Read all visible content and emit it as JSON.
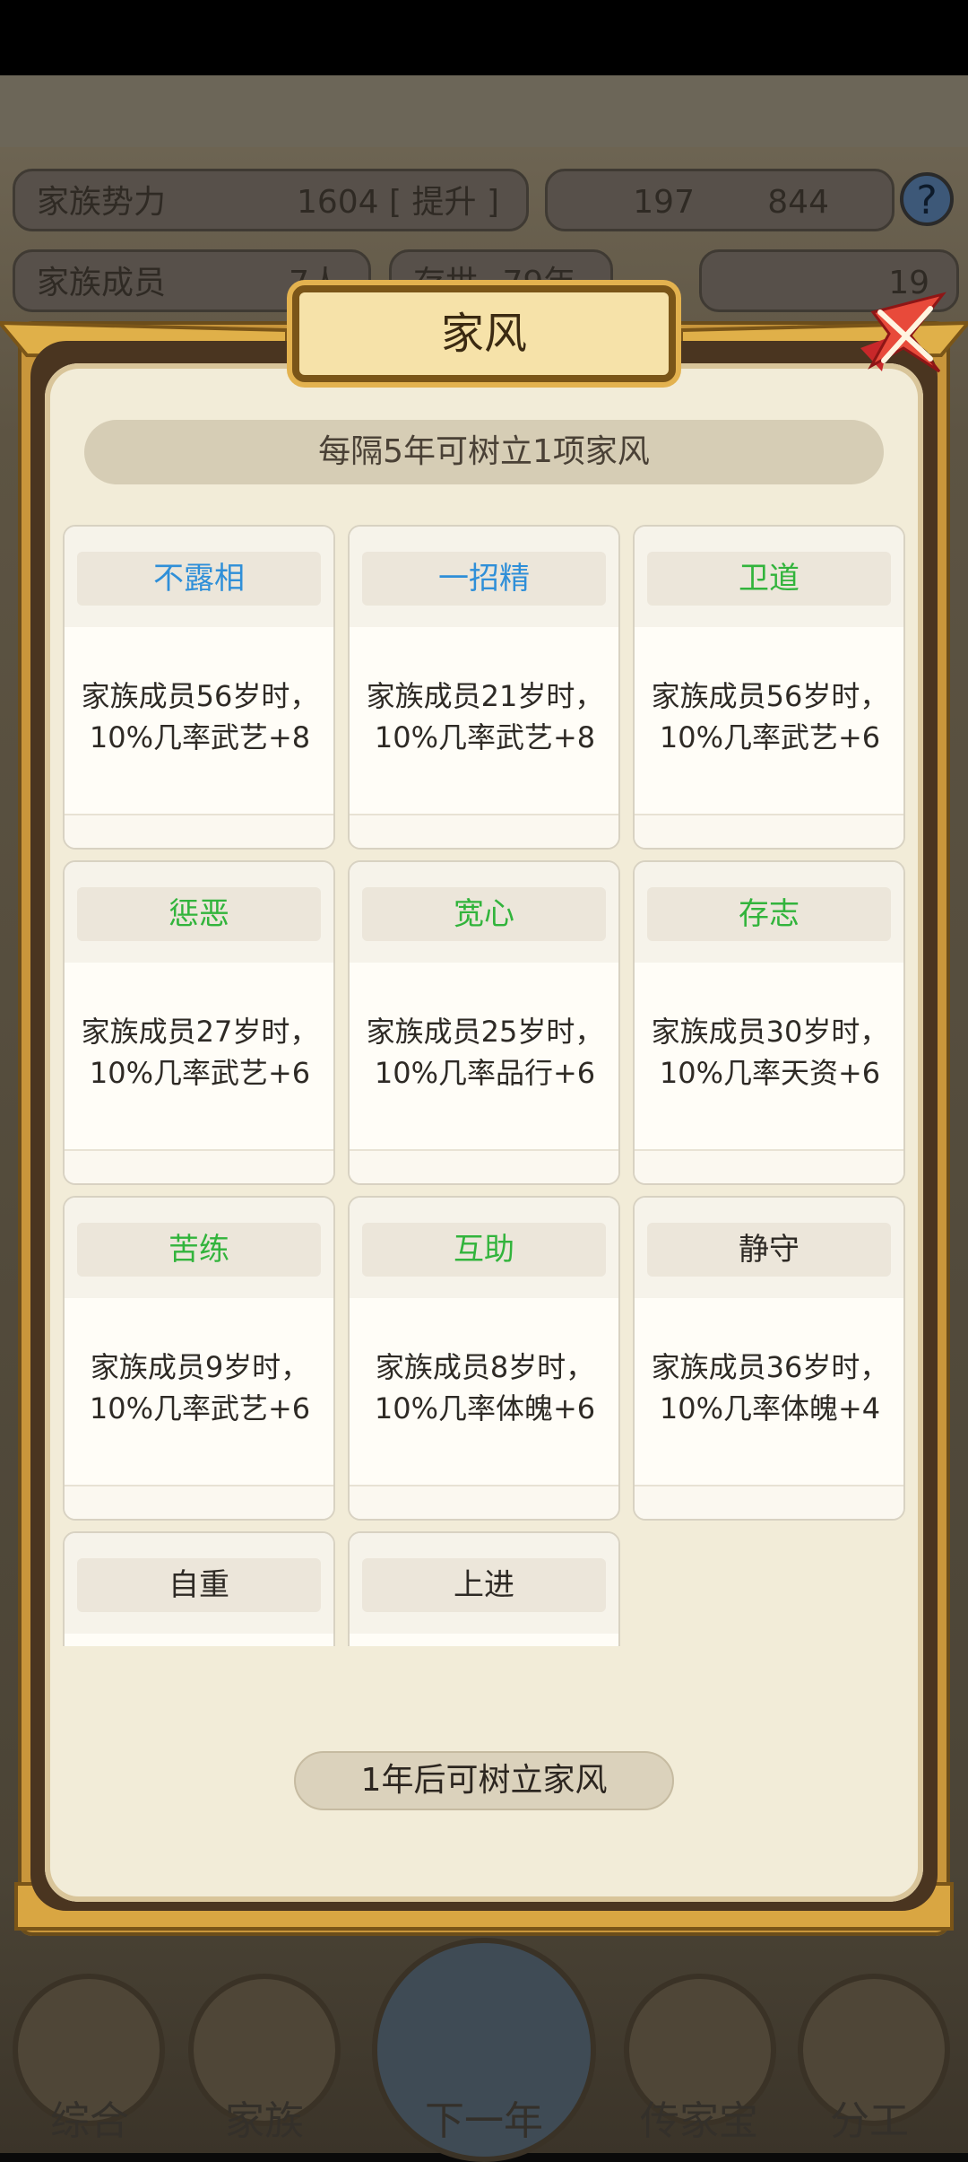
{
  "background": {
    "stats": [
      {
        "label": "家族势力",
        "value": "1604 [ 提升 ]"
      },
      {
        "label": "家族成员",
        "value": "7人"
      },
      {
        "label": "存世",
        "value": "79年"
      }
    ],
    "currency": {
      "silver": "197",
      "coins": "844",
      "gold": "19"
    },
    "nav": [
      "综合",
      "家族",
      "下一年",
      "传家宝",
      "分工"
    ]
  },
  "modal": {
    "title": "家风",
    "hint": "每隔5年可树立1项家风",
    "cards": [
      {
        "name": "不露相",
        "desc": "家族成员56岁时，10%几率武艺+8",
        "color": "#2f8fd8"
      },
      {
        "name": "一招精",
        "desc": "家族成员21岁时，10%几率武艺+8",
        "color": "#2f8fd8"
      },
      {
        "name": "卫道",
        "desc": "家族成员56岁时，10%几率武艺+6",
        "color": "#32b43c"
      },
      {
        "name": "惩恶",
        "desc": "家族成员27岁时，10%几率武艺+6",
        "color": "#32b43c"
      },
      {
        "name": "宽心",
        "desc": "家族成员25岁时，10%几率品行+6",
        "color": "#32b43c"
      },
      {
        "name": "存志",
        "desc": "家族成员30岁时，10%几率天资+6",
        "color": "#32b43c"
      },
      {
        "name": "苦练",
        "desc": "家族成员9岁时，10%几率武艺+6",
        "color": "#32b43c"
      },
      {
        "name": "互助",
        "desc": "家族成员8岁时，10%几率体魄+6",
        "color": "#32b43c"
      },
      {
        "name": "静守",
        "desc": "家族成员36岁时，10%几率体魄+4",
        "color": "#2e2a25"
      },
      {
        "name": "自重",
        "desc": "",
        "color": "#2e2a25"
      },
      {
        "name": "上进",
        "desc": "",
        "color": "#2e2a25"
      }
    ],
    "bottom_hint": "1年后可树立家风"
  }
}
